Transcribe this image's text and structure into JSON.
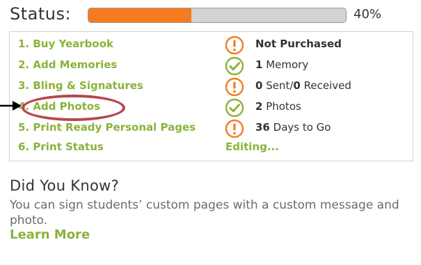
{
  "status": {
    "title": "Status:",
    "progress_percent": 40,
    "progress_label": "40%",
    "track_color": "#d3d3d3",
    "fill_color": "#f47b20"
  },
  "steps": [
    {
      "label": "1. Buy Yearbook",
      "icon": "warning-icon",
      "status_bold": "Not Purchased",
      "status_rest": ""
    },
    {
      "label": "2. Add Memories",
      "icon": "check-icon",
      "status_bold": "1",
      "status_rest": " Memory"
    },
    {
      "label": "3. Bling & Signatures",
      "icon": "warning-icon",
      "status_bold": "0",
      "status_rest": " Sent/",
      "status_bold2": "0",
      "status_rest2": " Received"
    },
    {
      "label": "4. Add Photos",
      "icon": "check-icon",
      "status_bold": "2",
      "status_rest": " Photos"
    },
    {
      "label": "5. Print Ready Personal Pages",
      "icon": "warning-icon",
      "status_bold": "36",
      "status_rest": " Days to Go"
    },
    {
      "label": "6. Print Status",
      "status_link": "Editing..."
    }
  ],
  "colors": {
    "green": "#8ab33b",
    "orange": "#f47b20",
    "highlight": "#b5474d"
  },
  "did_you_know": {
    "title": "Did You Know?",
    "body": "You can sign students’ custom pages with a custom message and photo.",
    "link": "Learn More"
  }
}
